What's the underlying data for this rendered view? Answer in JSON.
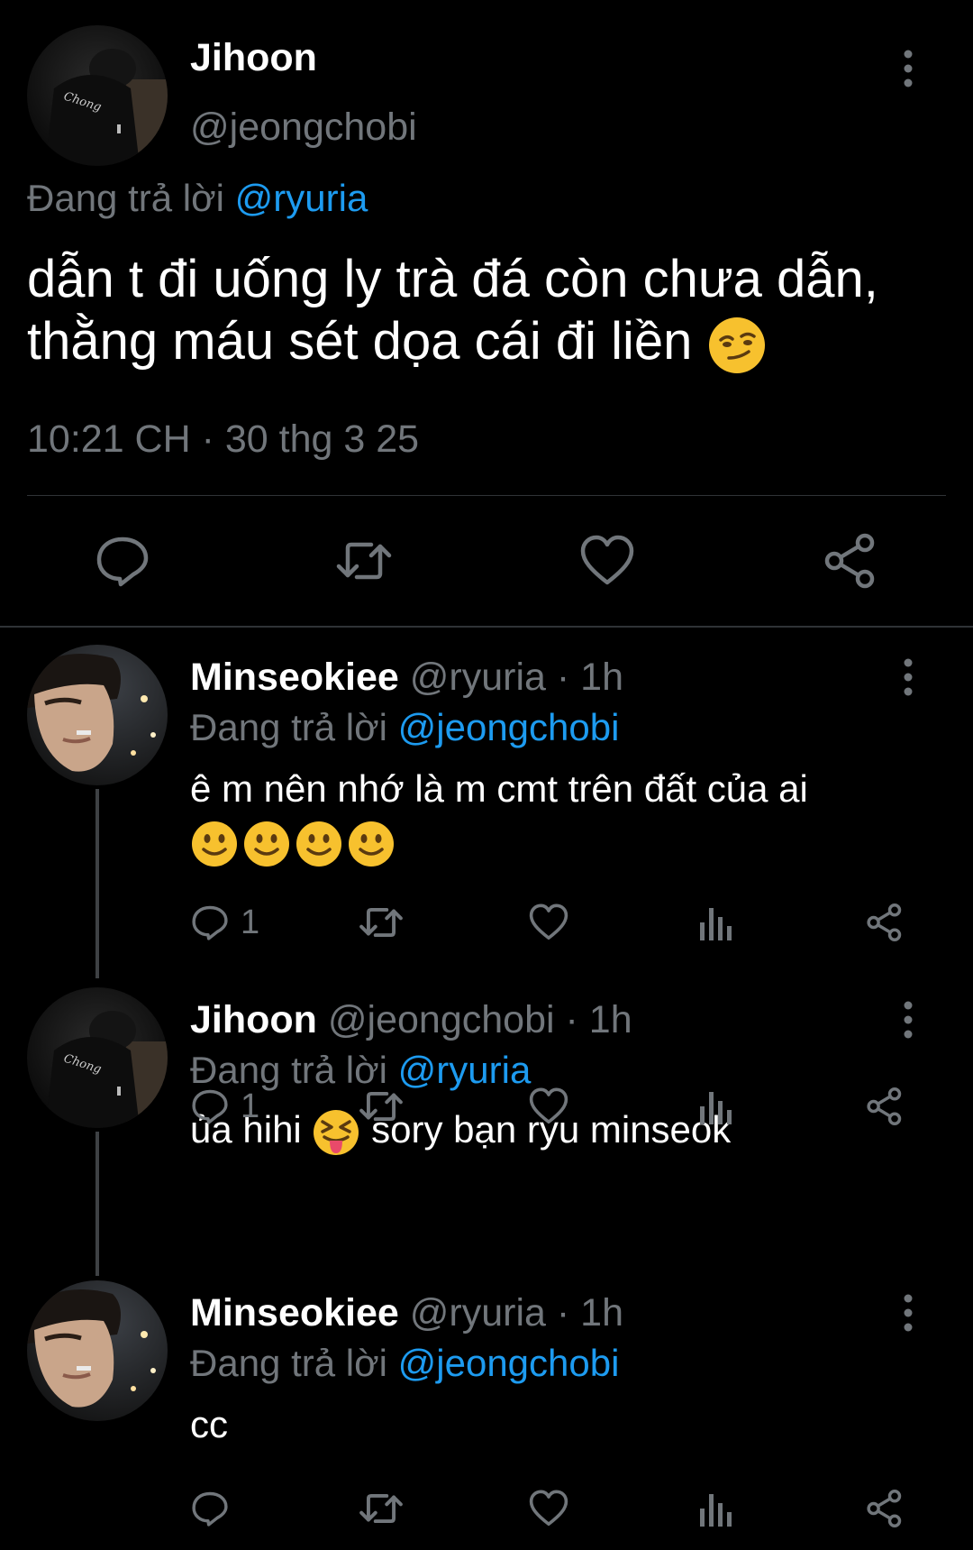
{
  "main_tweet": {
    "author_name": "Jihoon",
    "author_handle": "@jeongchobi",
    "avatar_print": "Chong",
    "replying_label": "Đang trả lời",
    "replying_to": "@ryuria",
    "text_line1": "dẫn t đi uống ly trà đá còn chưa dẫn,",
    "text_line2": "thằng máu sét dọa cái đi liền",
    "text_emoji": "smirking-face",
    "timestamp": "10:21 CH · 30 thg 3 25",
    "actions": [
      "reply-icon",
      "retweet-icon",
      "like-icon",
      "share-icon"
    ]
  },
  "replies": [
    {
      "author_name": "Minseokiee",
      "author_handle": "@ryuria",
      "time": "· 1h",
      "replying_label": "Đang trả lời",
      "replying_to": "@jeongchobi",
      "text": "ê m nên nhớ là m cmt trên đất của ai",
      "emoji": "slightly-smiling-face",
      "emoji_count": 4,
      "reply_count": "1"
    },
    {
      "author_name": "Jihoon",
      "author_handle": "@jeongchobi",
      "time": "· 1h",
      "replying_label": "Đang trả lời",
      "replying_to": "@ryuria",
      "text_before": "ủa hihi",
      "emoji": "squinting-face-with-tongue",
      "text_after": "sory bạn ryu minseok",
      "reply_count": "1"
    },
    {
      "author_name": "Minseokiee",
      "author_handle": "@ryuria",
      "time": "· 1h",
      "replying_label": "Đang trả lời",
      "replying_to": "@jeongchobi",
      "text": "cc",
      "reply_count": ""
    }
  ],
  "colors": {
    "background": "#000000",
    "text": "#e7e9ea",
    "muted": "#71767b",
    "link": "#1d9bf0",
    "divider": "#2f3336",
    "emoji": "#f7c12e"
  }
}
